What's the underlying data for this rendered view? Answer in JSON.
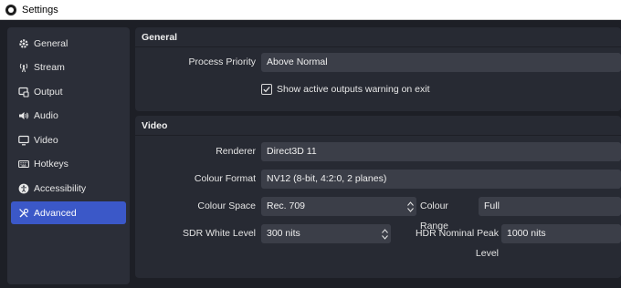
{
  "window": {
    "title": "Settings"
  },
  "sidebar": {
    "items": [
      {
        "label": "General",
        "icon": "gear-icon"
      },
      {
        "label": "Stream",
        "icon": "broadcast-icon"
      },
      {
        "label": "Output",
        "icon": "output-icon"
      },
      {
        "label": "Audio",
        "icon": "speaker-icon"
      },
      {
        "label": "Video",
        "icon": "monitor-icon"
      },
      {
        "label": "Hotkeys",
        "icon": "keyboard-icon"
      },
      {
        "label": "Accessibility",
        "icon": "accessibility-icon"
      },
      {
        "label": "Advanced",
        "icon": "tools-icon",
        "active": true
      }
    ]
  },
  "general": {
    "header": "General",
    "process_priority_label": "Process Priority",
    "process_priority_value": "Above Normal",
    "show_warning_label": "Show active outputs warning on exit",
    "show_warning_checked": true
  },
  "video": {
    "header": "Video",
    "renderer_label": "Renderer",
    "renderer_value": "Direct3D 11",
    "colour_format_label": "Colour Format",
    "colour_format_value": "NV12 (8-bit, 4:2:0, 2 planes)",
    "colour_space_label": "Colour Space",
    "colour_space_value": "Rec. 709",
    "colour_range_label": "Colour Range",
    "colour_range_value": "Full",
    "sdr_white_label": "SDR White Level",
    "sdr_white_value": "300 nits",
    "hdr_peak_label": "HDR Nominal Peak Level",
    "hdr_peak_value": "1000 nits"
  },
  "colors": {
    "accent": "#3b58c8",
    "background": "#1d1f26",
    "panel": "#272a33",
    "field": "#3b3e48"
  }
}
